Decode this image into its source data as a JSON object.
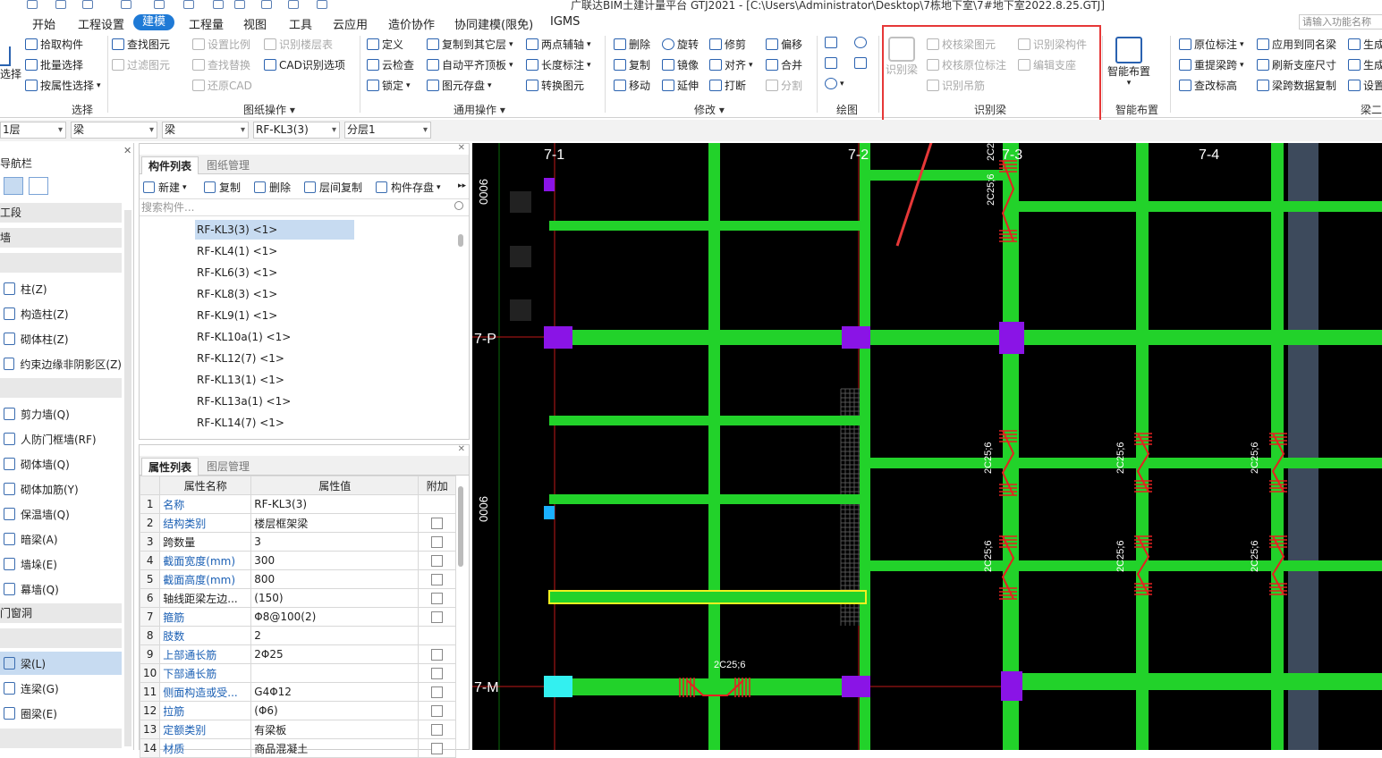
{
  "window_title": "广联达BIM土建计量平台 GTJ2021 - [C:\\Users\\Administrator\\Desktop\\7栋地下室\\7#地下室2022.8.25.GTJ]",
  "menu": [
    "开始",
    "工程设置",
    "建模",
    "工程量",
    "视图",
    "工具",
    "云应用",
    "造价协作",
    "协同建模(限免)",
    "IGMS"
  ],
  "search_placeholder": "请输入功能名称",
  "ribbon": {
    "select_label": "选择",
    "groups": {
      "select": "选择",
      "drawing_ops": "图纸操作",
      "common_ops": "通用操作",
      "modify": "修改",
      "draw": "绘图",
      "identify_beam": "识别梁",
      "smart_layout": "智能布置",
      "beam_two": "梁二"
    },
    "select_items": [
      "拾取构件",
      "批量选择",
      "按属性选择"
    ],
    "drawing_items": [
      "查找图元",
      "过滤图元",
      "设置比例",
      "识别楼层表",
      "查找替换",
      "CAD识别选项",
      "还原CAD"
    ],
    "common_items": [
      "定义",
      "复制到其它层",
      "两点辅轴",
      "云检查",
      "自动平齐顶板",
      "长度标注",
      "锁定",
      "图元存盘",
      "转换图元"
    ],
    "modify_items": [
      "删除",
      "旋转",
      "修剪",
      "偏移",
      "复制",
      "镜像",
      "对齐",
      "合并",
      "移动",
      "延伸",
      "打断",
      "分割"
    ],
    "identify_items": [
      "识别梁",
      "校核梁图元",
      "识别梁构件",
      "校核原位标注",
      "编辑支座",
      "识别吊筋"
    ],
    "smart_item": "智能布置",
    "beam_items": [
      "原位标注",
      "应用到同名梁",
      "重提梁跨",
      "刷新支座尺寸",
      "查改标高",
      "梁跨数据复制",
      "生成",
      "生成",
      "设置"
    ]
  },
  "selectors": [
    "1层",
    "梁",
    "梁",
    "RF-KL3(3)",
    "分层1"
  ],
  "nav": {
    "title": "导航栏",
    "headers": [
      "工段",
      "墙",
      "",
      "",
      "门窗洞",
      ""
    ],
    "items": [
      "柱(Z)",
      "构造柱(Z)",
      "砌体柱(Z)",
      "约束边缘非阴影区(Z)",
      "剪力墙(Q)",
      "人防门框墙(RF)",
      "砌体墙(Q)",
      "砌体加筋(Y)",
      "保温墙(Q)",
      "暗梁(A)",
      "墙垛(E)",
      "幕墙(Q)",
      "梁(L)",
      "连梁(G)",
      "圈梁(E)"
    ]
  },
  "component_panel": {
    "tabs": [
      "构件列表",
      "图纸管理"
    ],
    "toolbar": [
      "新建",
      "复制",
      "删除",
      "层间复制",
      "构件存盘"
    ],
    "search_placeholder": "搜索构件...",
    "items": [
      "RF-KL3(3) <1>",
      "RF-KL4(1) <1>",
      "RF-KL6(3) <1>",
      "RF-KL8(3) <1>",
      "RF-KL9(1) <1>",
      "RF-KL10a(1) <1>",
      "RF-KL12(7) <1>",
      "RF-KL13(1) <1>",
      "RF-KL13a(1) <1>",
      "RF-KL14(7) <1>"
    ],
    "selected_index": 0
  },
  "property_panel": {
    "tabs": [
      "属性列表",
      "图层管理"
    ],
    "headers": [
      "属性名称",
      "属性值",
      "附加"
    ],
    "rows": [
      {
        "n": "1",
        "k": "名称",
        "v": "RF-KL3(3)",
        "blue": true,
        "cb": false
      },
      {
        "n": "2",
        "k": "结构类别",
        "v": "楼层框架梁",
        "blue": true,
        "cb": true
      },
      {
        "n": "3",
        "k": "跨数量",
        "v": "3",
        "blue": false,
        "cb": true
      },
      {
        "n": "4",
        "k": "截面宽度(mm)",
        "v": "300",
        "blue": true,
        "cb": true
      },
      {
        "n": "5",
        "k": "截面高度(mm)",
        "v": "800",
        "blue": true,
        "cb": true
      },
      {
        "n": "6",
        "k": "轴线距梁左边...",
        "v": "(150)",
        "blue": false,
        "cb": true
      },
      {
        "n": "7",
        "k": "箍筋",
        "v": "Φ8@100(2)",
        "blue": true,
        "cb": true
      },
      {
        "n": "8",
        "k": "肢数",
        "v": "2",
        "blue": true,
        "cb": false
      },
      {
        "n": "9",
        "k": "上部通长筋",
        "v": "2Φ25",
        "blue": true,
        "cb": true
      },
      {
        "n": "10",
        "k": "下部通长筋",
        "v": "",
        "blue": true,
        "cb": true
      },
      {
        "n": "11",
        "k": "侧面构造或受...",
        "v": "G4Φ12",
        "blue": true,
        "cb": true
      },
      {
        "n": "12",
        "k": "拉筋",
        "v": "(Φ6)",
        "blue": true,
        "cb": true
      },
      {
        "n": "13",
        "k": "定额类别",
        "v": "有梁板",
        "blue": true,
        "cb": true
      },
      {
        "n": "14",
        "k": "材质",
        "v": "商品混凝土",
        "blue": true,
        "cb": true
      }
    ]
  },
  "canvas": {
    "axis_labels": [
      "7-1",
      "7-2",
      "7-3",
      "7-4",
      "7-P",
      "7-M"
    ],
    "dim_labels": [
      "9000",
      "9000"
    ],
    "rebar_labels": [
      "2C25;6",
      "2C25;6",
      "2C25;6",
      "2C25;6",
      "2C25;6",
      "2C25;6",
      "2C25;6",
      "2C25;6",
      "2C25;6"
    ],
    "colors": {
      "beam": "#22d22a",
      "column": "#8a14e6",
      "rebar": "#e62020",
      "axis": "#c01818",
      "selected": "#f0f020",
      "dark_band": "#3d4a5c"
    }
  }
}
